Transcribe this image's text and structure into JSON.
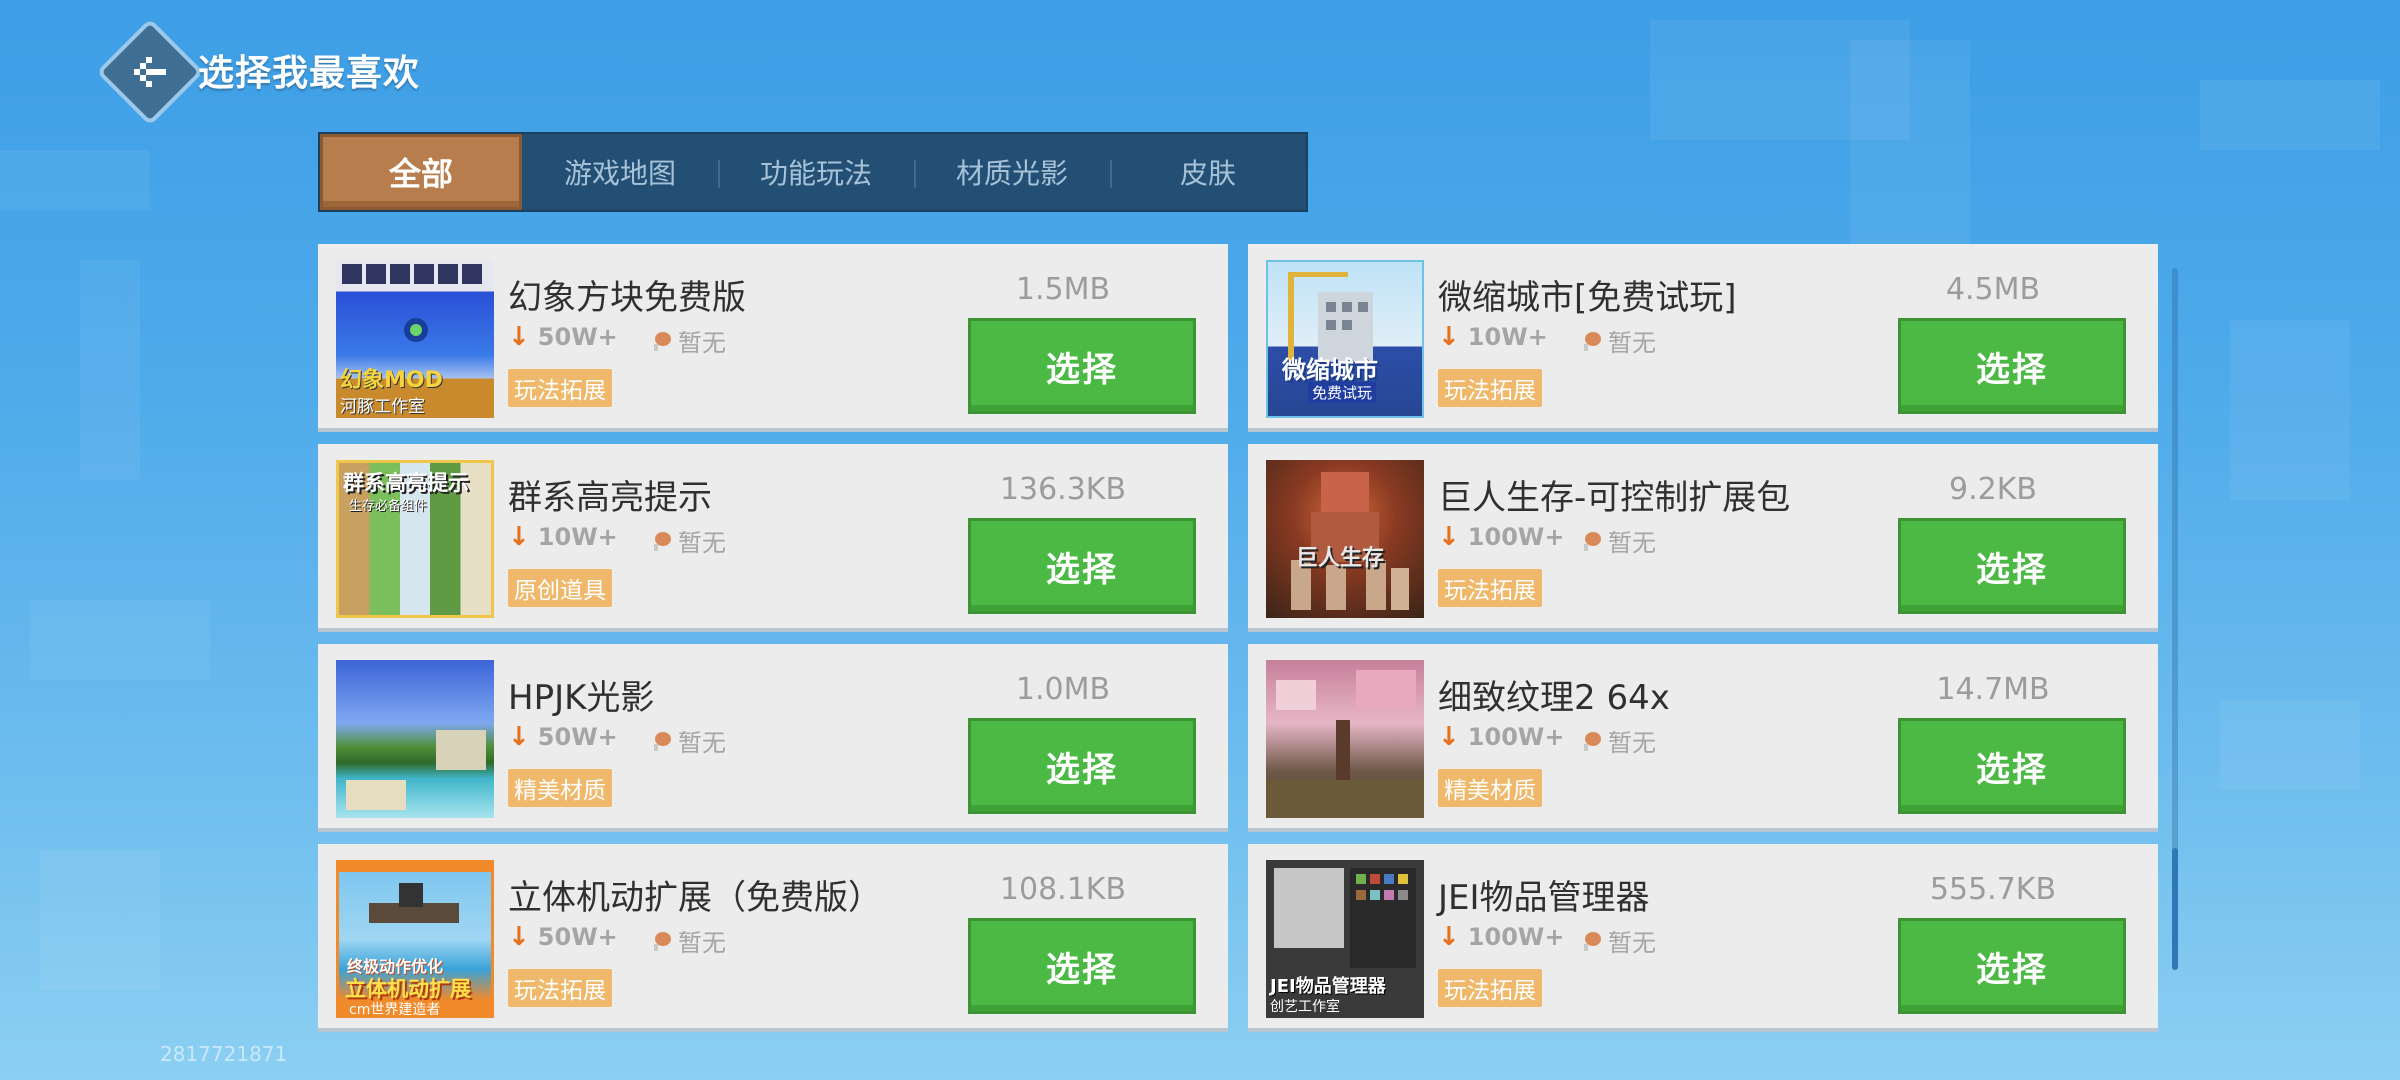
{
  "header": {
    "title": "选择我最喜欢"
  },
  "tabs": [
    {
      "label": "全部",
      "active": true
    },
    {
      "label": "游戏地图",
      "active": false
    },
    {
      "label": "功能玩法",
      "active": false
    },
    {
      "label": "材质光影",
      "active": false
    },
    {
      "label": "皮肤",
      "active": false
    }
  ],
  "items": [
    {
      "name": "幻象方块免费版",
      "downloads": "50W+",
      "rating": "暂无",
      "tag": "玩法拓展",
      "size": "1.5MB",
      "button": "选择",
      "thumb_lines": [
        "幻象MOD",
        "河豚工作室"
      ]
    },
    {
      "name": "微缩城市[免费试玩]",
      "downloads": "10W+",
      "rating": "暂无",
      "tag": "玩法拓展",
      "size": "4.5MB",
      "button": "选择",
      "thumb_lines": [
        "微缩城市",
        "免费试玩"
      ]
    },
    {
      "name": "群系高亮提示",
      "downloads": "10W+",
      "rating": "暂无",
      "tag": "原创道具",
      "size": "136.3KB",
      "button": "选择",
      "thumb_lines": [
        "群系高亮提示",
        "生存必备组件"
      ]
    },
    {
      "name": "巨人生存-可控制扩展包",
      "downloads": "100W+",
      "rating": "暂无",
      "tag": "玩法拓展",
      "size": "9.2KB",
      "button": "选择",
      "thumb_lines": [
        "巨人生存"
      ]
    },
    {
      "name": "HPJK光影",
      "downloads": "50W+",
      "rating": "暂无",
      "tag": "精美材质",
      "size": "1.0MB",
      "button": "选择",
      "thumb_lines": []
    },
    {
      "name": "细致纹理2 64x",
      "downloads": "100W+",
      "rating": "暂无",
      "tag": "精美材质",
      "size": "14.7MB",
      "button": "选择",
      "thumb_lines": []
    },
    {
      "name": "立体机动扩展（免费版）",
      "downloads": "50W+",
      "rating": "暂无",
      "tag": "玩法拓展",
      "size": "108.1KB",
      "button": "选择",
      "thumb_lines": [
        "终极动作优化",
        "立体机动扩展",
        "cm世界建造者"
      ]
    },
    {
      "name": "JEI物品管理器",
      "downloads": "100W+",
      "rating": "暂无",
      "tag": "玩法拓展",
      "size": "555.7KB",
      "button": "选择",
      "thumb_lines": [
        "JEI物品管理器",
        "创艺工作室"
      ]
    }
  ],
  "footer": {
    "user_id": "2817721871"
  },
  "colors": {
    "select_green": "#4cb944",
    "tab_active": "#b77d4d",
    "tag_orange": "#f0b86b",
    "download_arrow": "#e4701d"
  }
}
